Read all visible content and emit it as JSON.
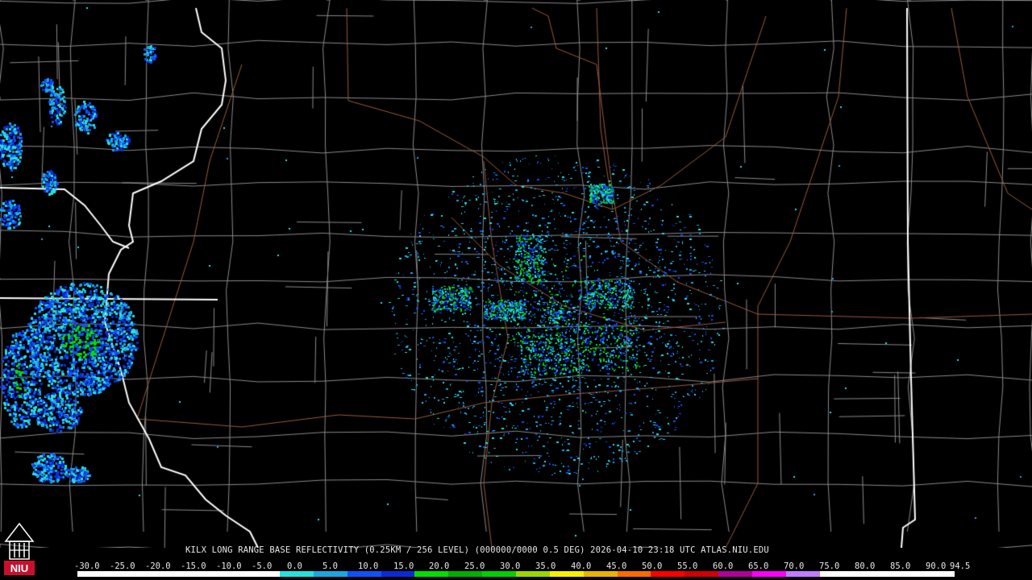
{
  "map": {
    "description_free": true,
    "colors": {
      "background": "#000000",
      "county_lines": "#8a8a8a",
      "state_lines": "#ffffff",
      "roads": "#9a5a3c"
    }
  },
  "caption": "KILX LONG RANGE BASE REFLECTIVITY (0.25KM / 256 LEVEL) (000000/0000 0.5 DEG) 2026-04-10 23:18 UTC  ATLAS.NIU.EDU",
  "scale": {
    "labels": [
      "-30.0",
      "-25.0",
      "-20.0",
      "-15.0",
      "-10.0",
      "-5.0",
      "0.0",
      "5.0",
      "10.0",
      "15.0",
      "20.0",
      "25.0",
      "30.0",
      "35.0",
      "40.0",
      "45.0",
      "50.0",
      "55.0",
      "60.0",
      "65.0",
      "70.0",
      "75.0",
      "80.0",
      "85.0",
      "90.0",
      "94.5"
    ],
    "colors": [
      "#ffffff",
      "#ffffff",
      "#ffffff",
      "#ffffff",
      "#ffffff",
      "#ffffff",
      "#27e0e0",
      "#1aa7e0",
      "#1050ff",
      "#0a2ad8",
      "#00e000",
      "#00b000",
      "#00d000",
      "#9ad600",
      "#f8f000",
      "#e8b400",
      "#ff6a00",
      "#ff0000",
      "#d00000",
      "#b0009a",
      "#ff00ff",
      "#c27cff",
      "#ffffff",
      "#ffffff",
      "#ffffff",
      "#ffffff"
    ]
  },
  "logo": {
    "text": "NIU",
    "icon": "niu-tower-logo-icon",
    "color": "#c8102e"
  }
}
